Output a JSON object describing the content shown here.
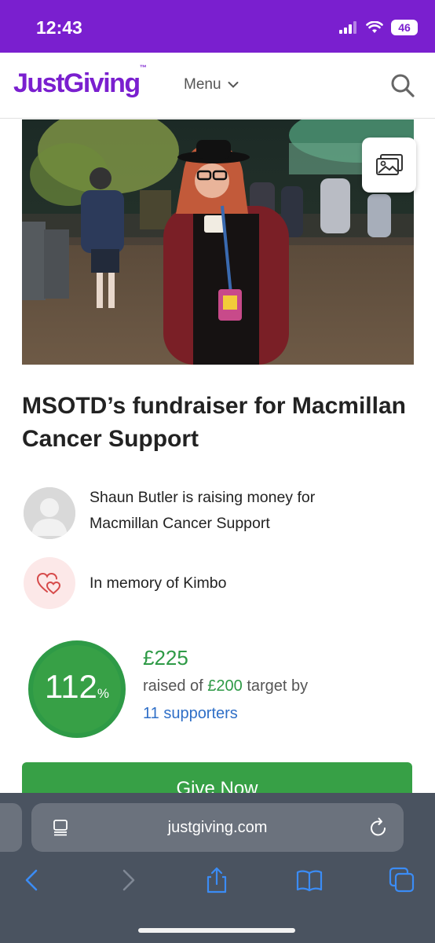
{
  "status_bar": {
    "time": "12:43",
    "battery": "46"
  },
  "header": {
    "logo": "JustGiving",
    "logo_tm": "™",
    "menu_label": "Menu"
  },
  "fundraiser": {
    "title": "MSOTD’s fundraiser for Macmillan Cancer Support",
    "organiser_text": "Shaun Butler is raising money for Macmillan Cancer Support",
    "memory_text": "In memory of Kimbo"
  },
  "progress": {
    "percent": "112",
    "percent_symbol": "%",
    "raised": "£225",
    "raised_prefix": "raised of",
    "target": "£200",
    "raised_suffix": "target by",
    "supporters": "11 supporters",
    "fill_fraction": 1.0
  },
  "cta": {
    "give_label": "Give Now"
  },
  "browser": {
    "url": "justgiving.com"
  },
  "colors": {
    "brand": "#7a1fcf",
    "success": "#37a046",
    "link": "#2f6fc7",
    "safari_bar": "#4a5360"
  },
  "icons": [
    "signal-icon",
    "wifi-icon",
    "battery-icon",
    "chevron-down-icon",
    "search-icon",
    "gallery-icon",
    "avatar-icon",
    "heart-icon",
    "reader-icon",
    "reload-icon",
    "back-icon",
    "forward-icon",
    "share-icon",
    "bookmarks-icon",
    "tabs-icon"
  ]
}
